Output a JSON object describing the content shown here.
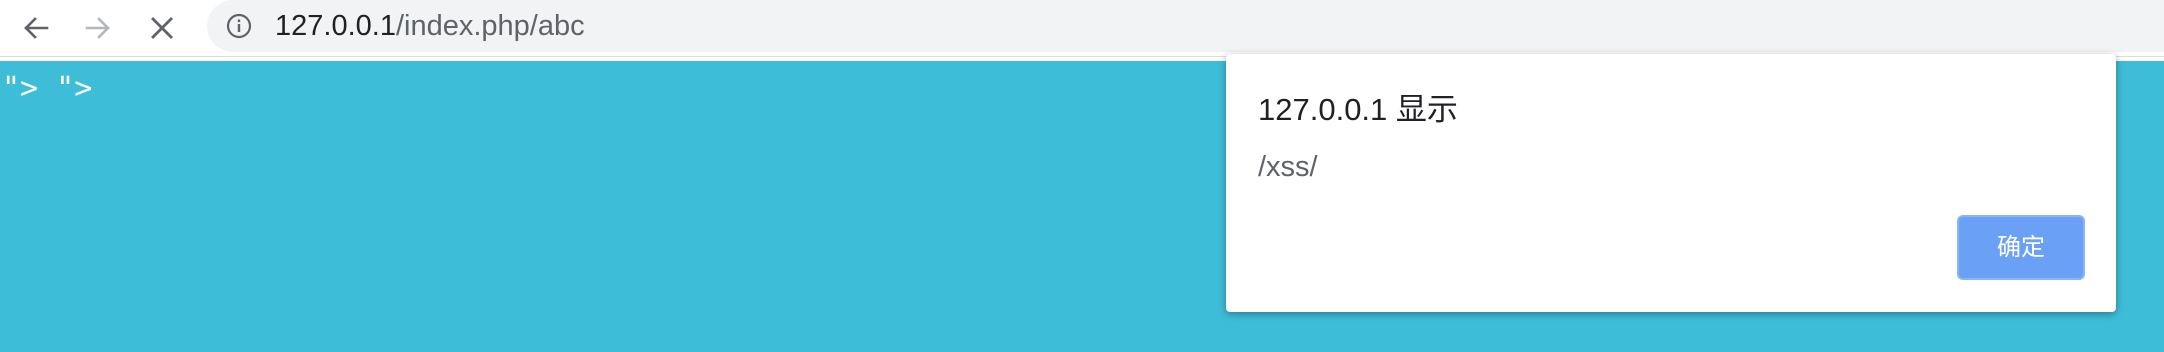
{
  "browser": {
    "back_icon": "arrow-left-icon",
    "forward_icon": "arrow-right-icon",
    "stop_icon": "close-icon",
    "site_info_icon": "info-icon",
    "url_host": "127.0.0.1",
    "url_path": "/index.php/abc"
  },
  "page": {
    "background_color": "#3ebdd9",
    "text": "\"> \">"
  },
  "alert": {
    "title": "127.0.0.1 显示",
    "message": "/xss/",
    "ok_label": "确定",
    "ok_color": "#6aa1f7"
  }
}
